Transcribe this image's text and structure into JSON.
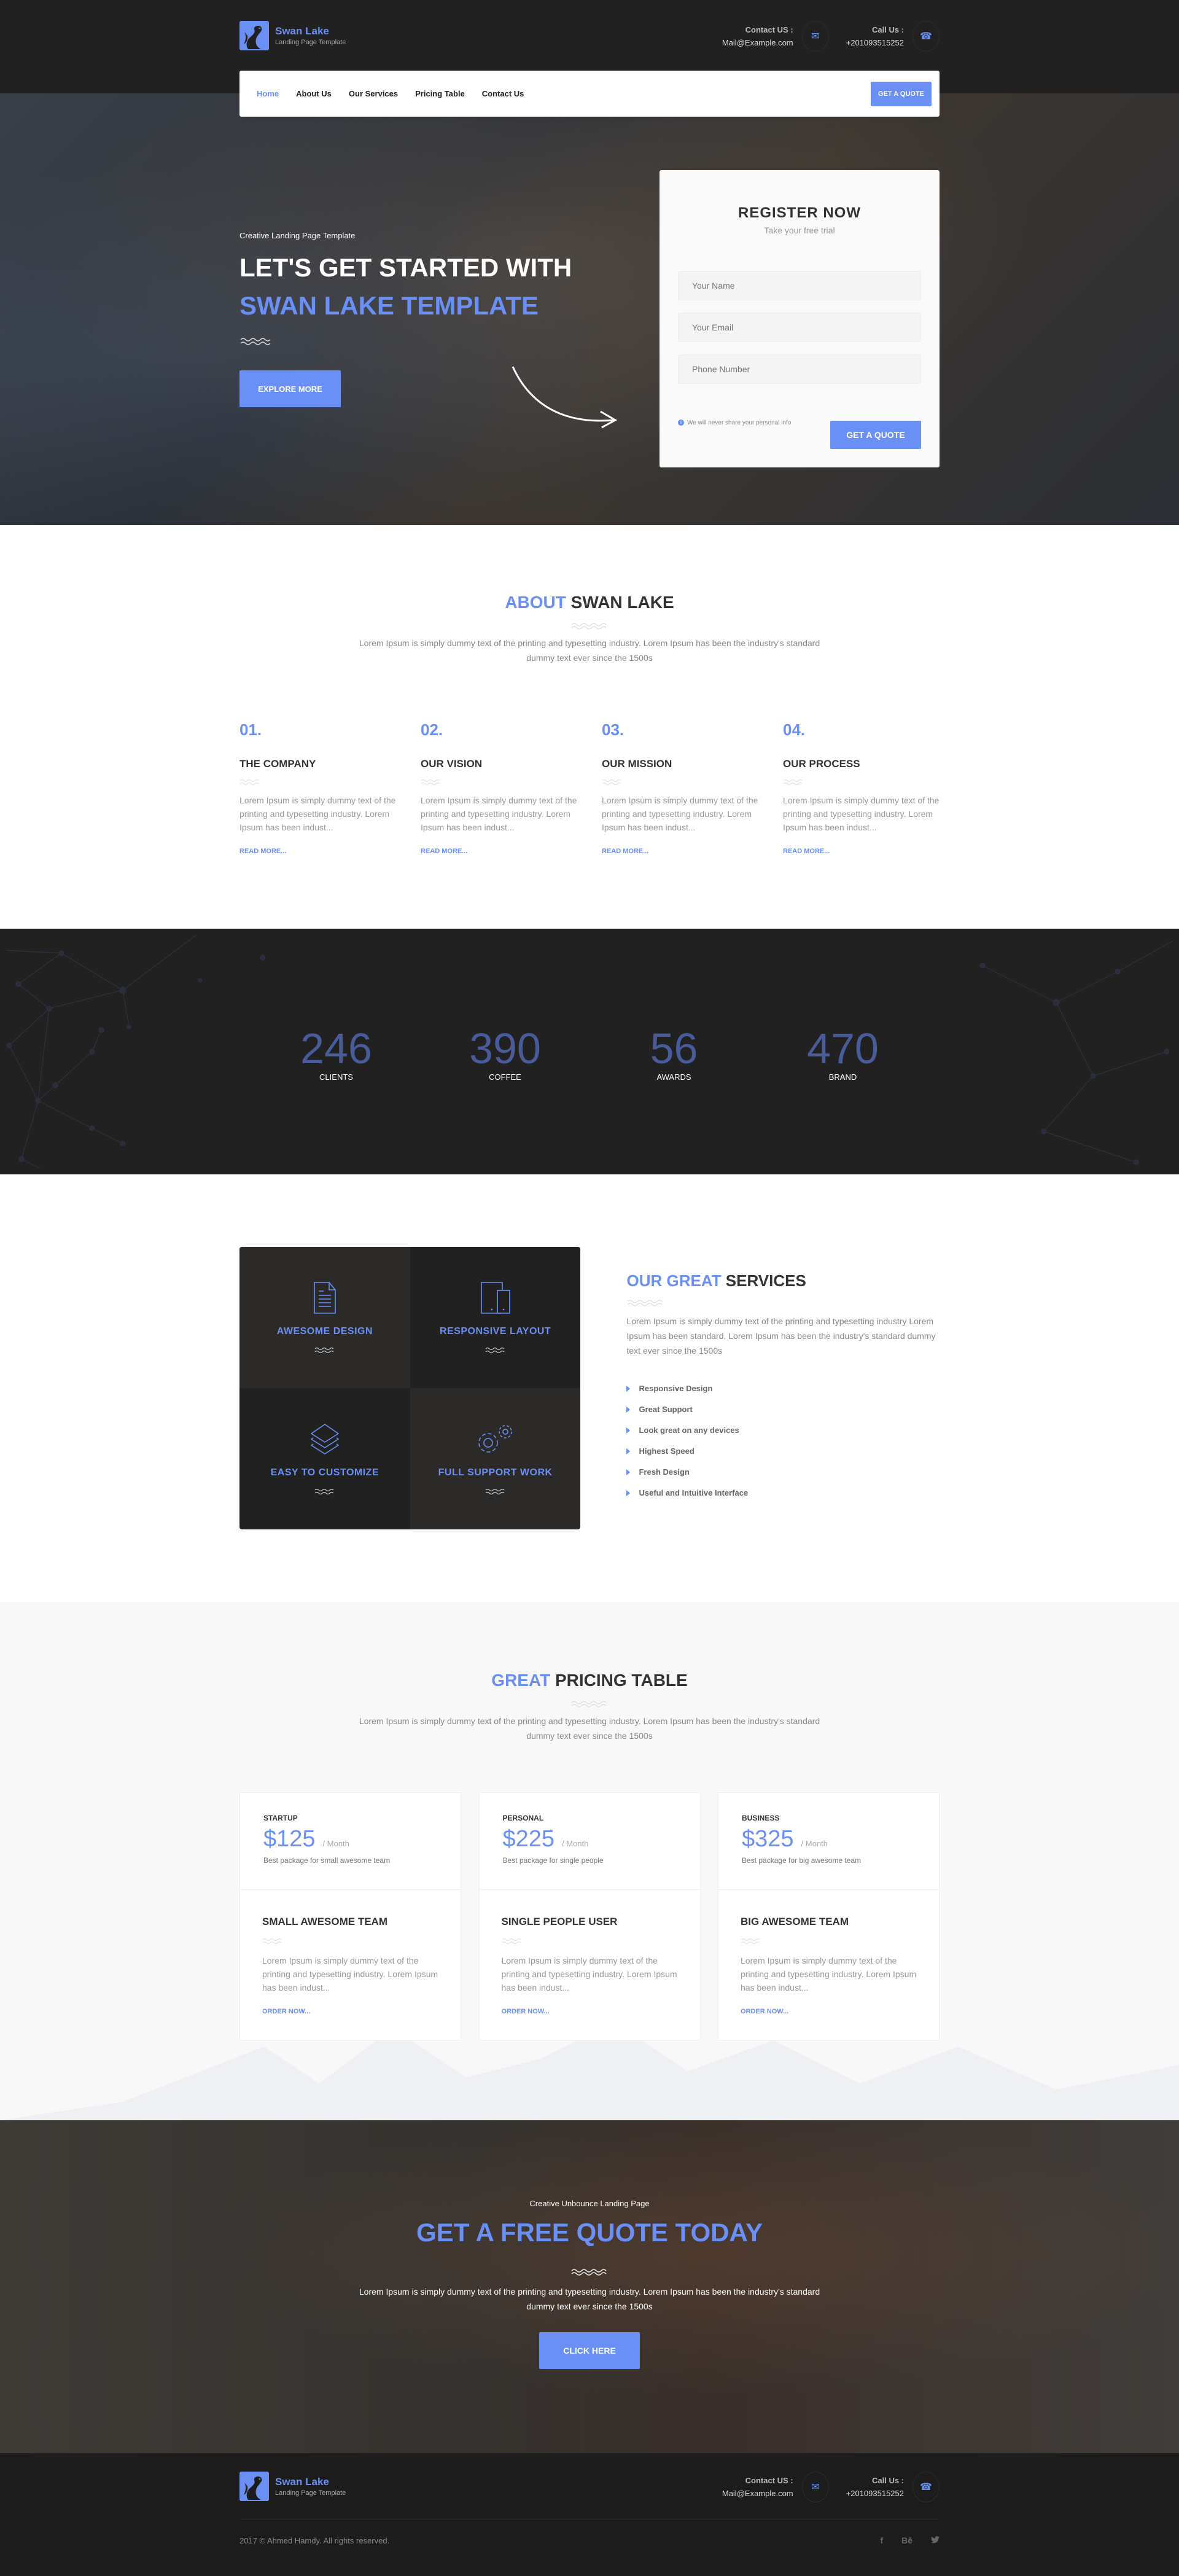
{
  "brand": {
    "name": "Swan Lake",
    "tagline": "Landing Page Template",
    "accent": "#6a8ff5"
  },
  "header": {
    "contact": {
      "label": "Contact US :",
      "value": "Mail@Example.com",
      "icon": "envelope-icon"
    },
    "call": {
      "label": "Call Us :",
      "value": "+201093515252",
      "icon": "phone-icon"
    }
  },
  "nav": {
    "items": [
      {
        "label": "Home",
        "active": true
      },
      {
        "label": "About Us"
      },
      {
        "label": "Our Services"
      },
      {
        "label": "Pricing Table"
      },
      {
        "label": "Contact Us"
      }
    ],
    "cta": "GET A QUOTE"
  },
  "hero": {
    "subtitle": "Creative Landing Page Template",
    "title_line1": "LET'S GET STARTED WITH",
    "title_line2": "SWAN LAKE TEMPLATE",
    "button": "EXPLORE MORE"
  },
  "register": {
    "title": "REGISTER NOW",
    "subtitle": "Take your free trial",
    "fields": [
      {
        "placeholder": "Your Name",
        "value": ""
      },
      {
        "placeholder": "Your Email",
        "value": ""
      },
      {
        "placeholder": "Phone Number",
        "value": ""
      }
    ],
    "note": "We will never share your personal info",
    "button": "GET A QUOTE"
  },
  "about": {
    "title_accent": "ABOUT",
    "title_rest": "SWAN LAKE",
    "description": "Lorem Ipsum is simply dummy text of the printing and typesetting industry. Lorem Ipsum has been the industry's standard dummy text ever since the 1500s",
    "items": [
      {
        "num": "01.",
        "title": "THE COMPANY",
        "text": "Lorem Ipsum is simply dummy text of the printing and typesetting industry. Lorem Ipsum has been indust...",
        "link": "READ MORE..."
      },
      {
        "num": "02.",
        "title": "OUR VISION",
        "text": "Lorem Ipsum is simply dummy text of the printing and typesetting industry. Lorem Ipsum has been indust...",
        "link": "READ MORE..."
      },
      {
        "num": "03.",
        "title": "OUR MISSION",
        "text": "Lorem Ipsum is simply dummy text of the printing and typesetting industry. Lorem Ipsum has been indust...",
        "link": "READ MORE..."
      },
      {
        "num": "04.",
        "title": "OUR PROCESS",
        "text": "Lorem Ipsum is simply dummy text of the printing and typesetting industry. Lorem Ipsum has been indust...",
        "link": "READ MORE..."
      }
    ]
  },
  "stats": [
    {
      "value": "246",
      "label": "CLIENTS"
    },
    {
      "value": "390",
      "label": "COFFEE"
    },
    {
      "value": "56",
      "label": "AWARDS"
    },
    {
      "value": "470",
      "label": "BRAND"
    }
  ],
  "services": {
    "tiles": [
      {
        "title": "AWESOME DESIGN",
        "icon": "document-icon"
      },
      {
        "title": "RESPONSIVE LAYOUT",
        "icon": "devices-icon"
      },
      {
        "title": "EASY TO CUSTOMIZE",
        "icon": "layers-icon"
      },
      {
        "title": "FULL SUPPORT WORK",
        "icon": "gears-icon"
      }
    ],
    "title_accent": "OUR GREAT",
    "title_rest": "SERVICES",
    "description": "Lorem Ipsum is simply dummy text of the printing and typesetting industry Lorem Ipsum has been standard. Lorem Ipsum has been the industry's standard dummy text ever since the 1500s",
    "list": [
      "Responsive Design",
      "Great Support",
      "Look great on any devices",
      "Highest Speed",
      "Fresh Design",
      "Useful and Intuitive Interface"
    ]
  },
  "pricing": {
    "title_accent": "GREAT",
    "title_rest": "PRICING TABLE",
    "description": "Lorem Ipsum is simply dummy text of the printing and typesetting industry. Lorem Ipsum has been the industry's standard dummy text ever since the 1500s",
    "plans": [
      {
        "name": "STARTUP",
        "price": "$125",
        "per": "/   Month",
        "desc": "Best package for small awesome team",
        "title": "SMALL AWESOME TEAM",
        "text": "Lorem Ipsum is simply dummy text of the printing and typesetting industry. Lorem Ipsum has been indust...",
        "link": "ORDER NOW..."
      },
      {
        "name": "PERSONAL",
        "price": "$225",
        "per": "/   Month",
        "desc": "Best package for single people",
        "title": "SINGLE PEOPLE USER",
        "text": "Lorem Ipsum is simply dummy text of the printing and typesetting industry. Lorem Ipsum has been indust...",
        "link": "ORDER NOW..."
      },
      {
        "name": "BUSINESS",
        "price": "$325",
        "per": "/   Month",
        "desc": "Best package for big awesome team",
        "title": "BIG AWESOME TEAM",
        "text": "Lorem Ipsum is simply dummy text of the printing and typesetting industry. Lorem Ipsum has been indust...",
        "link": "ORDER NOW..."
      }
    ]
  },
  "cta": {
    "subtitle": "Creative Unbounce Landing Page",
    "title": "GET A FREE QUOTE TODAY",
    "description": "Lorem Ipsum is simply dummy text of the printing and typesetting industry. Lorem Ipsum has been the industry's standard dummy text ever since the 1500s",
    "button": "CLICK HERE"
  },
  "footer": {
    "copyright": "2017 © Ahmed Hamdy. All rights reserved.",
    "social": [
      {
        "label": "f",
        "icon": "facebook-icon"
      },
      {
        "label": "Bē",
        "icon": "behance-icon"
      },
      {
        "label": "🐦",
        "icon": "twitter-icon"
      }
    ]
  }
}
